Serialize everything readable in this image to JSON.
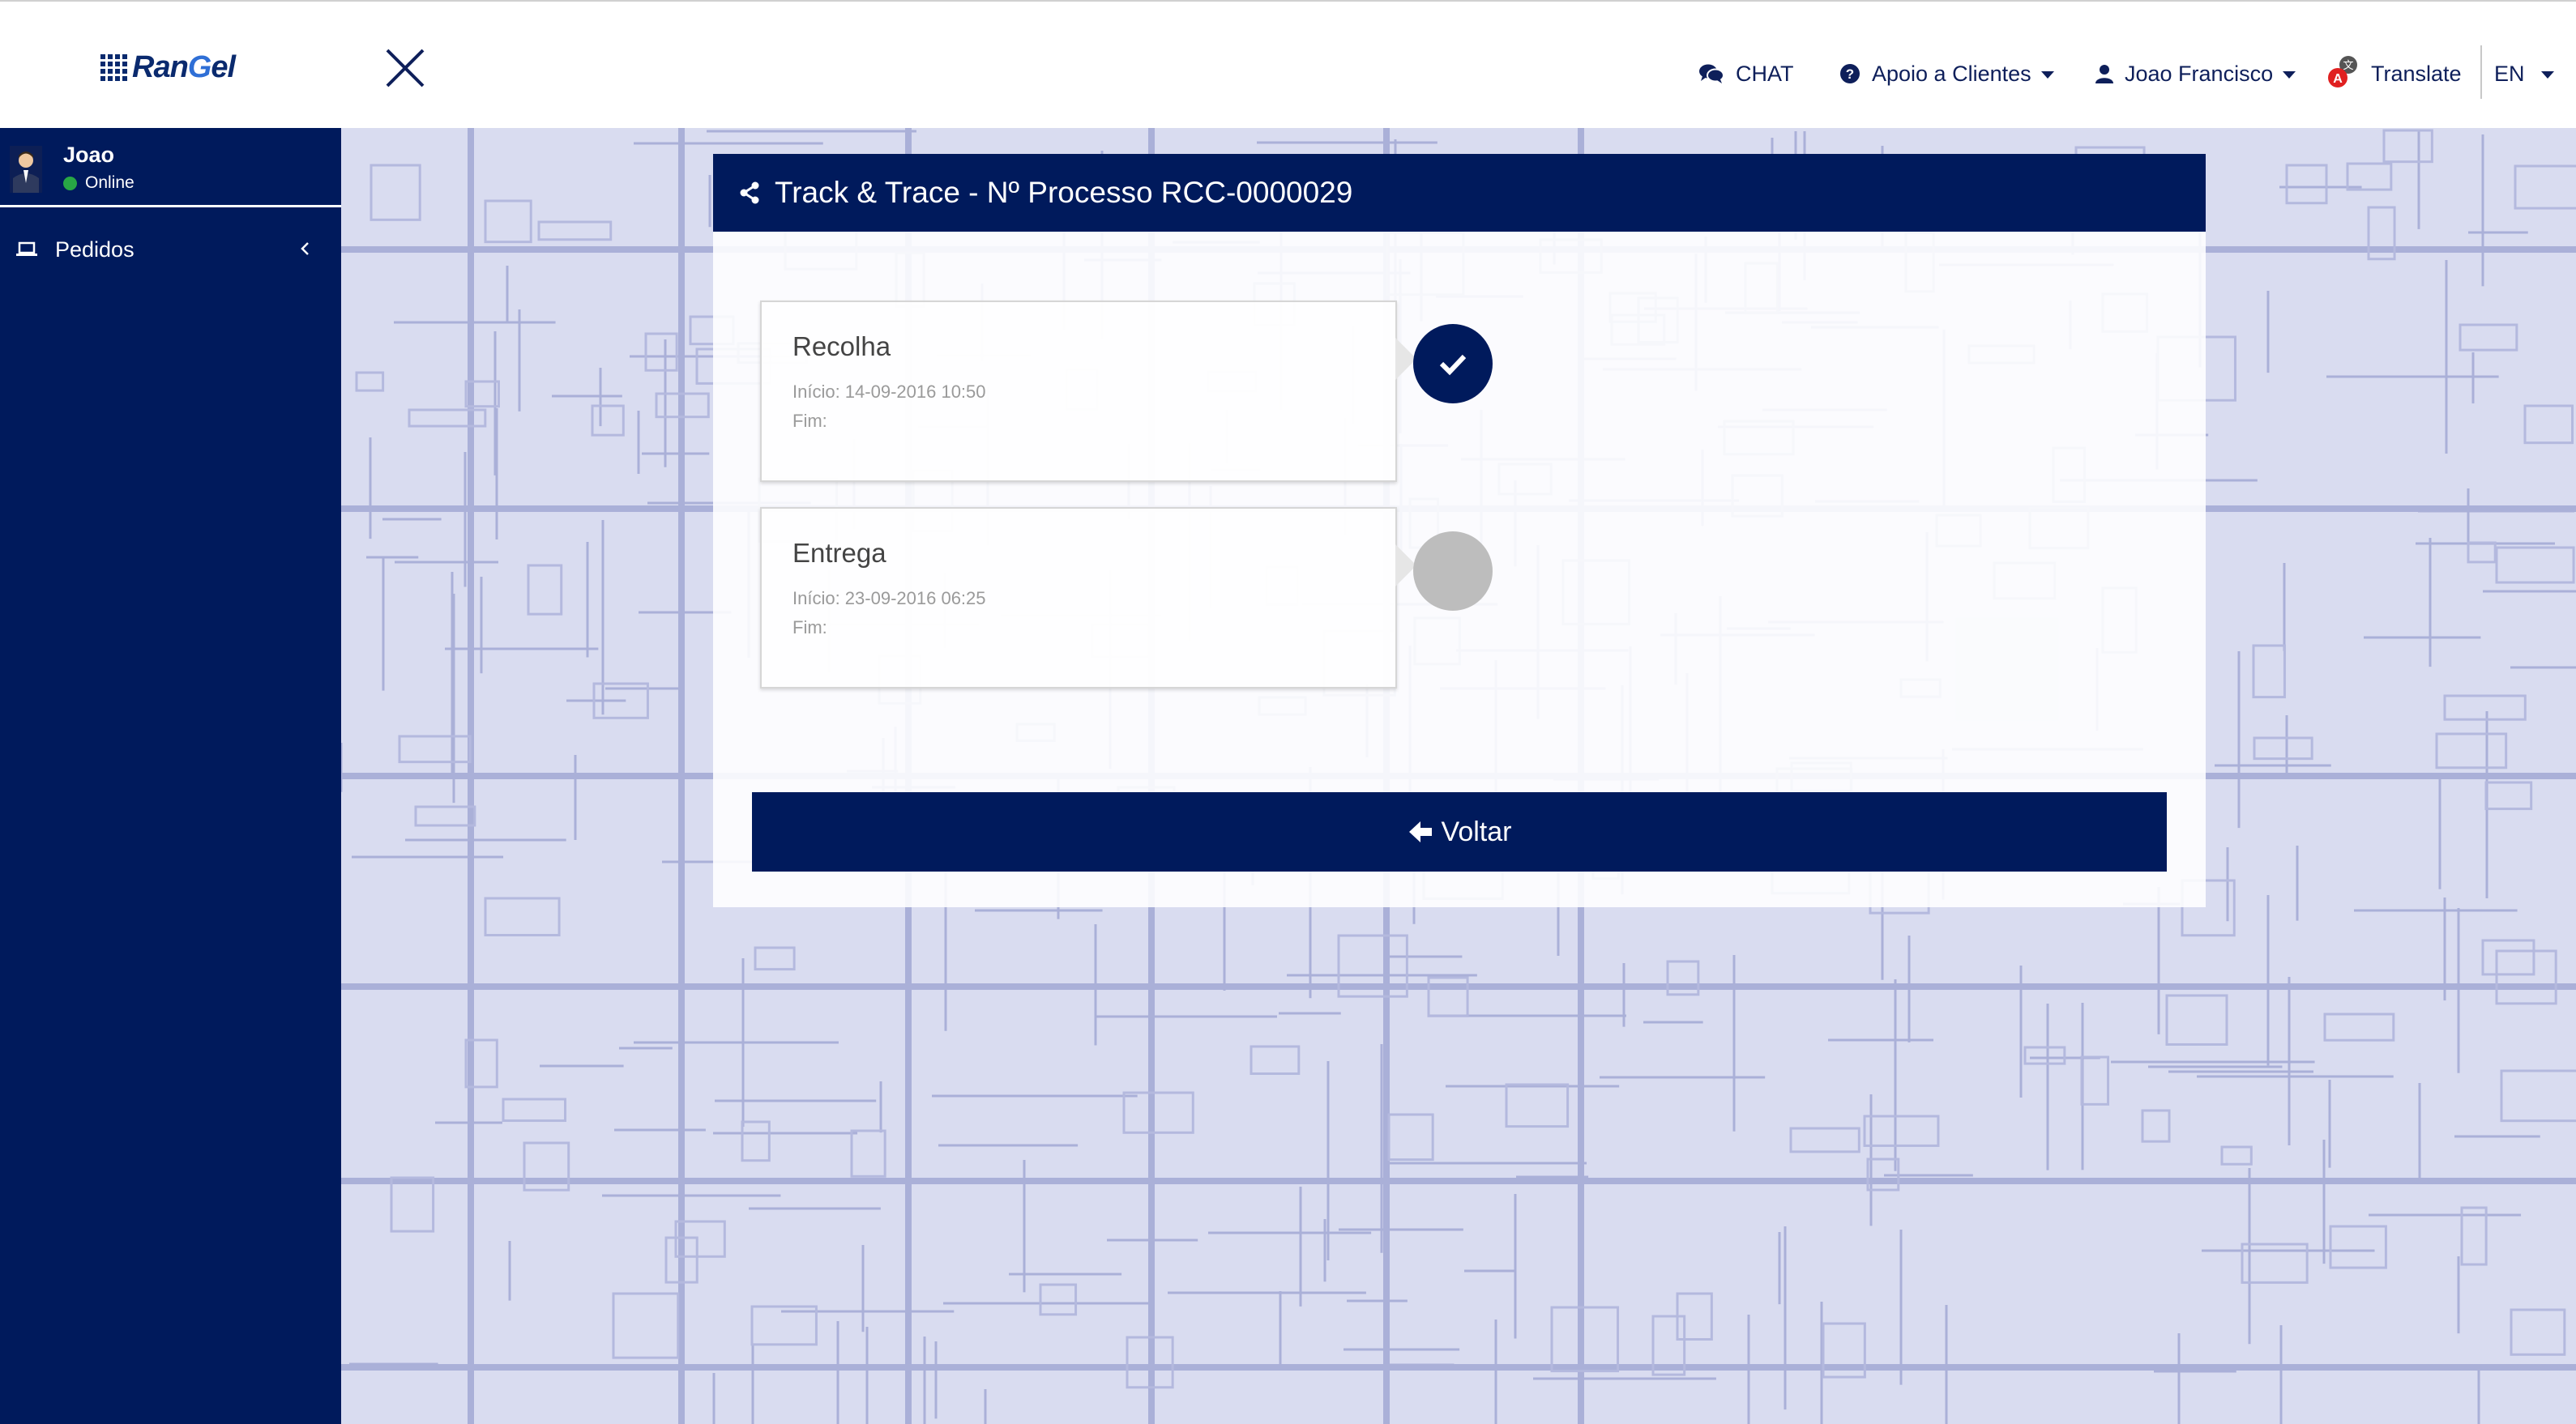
{
  "app": {
    "logo_text_prefix": "Ran",
    "logo_text_g": "G",
    "logo_text_suffix": "el"
  },
  "header": {
    "chat_label": "CHAT",
    "support_label": "Apoio a Clientes",
    "user_menu_label": "Joao Francisco",
    "translate_label": "Translate",
    "language_label": "EN",
    "translate_badge": "A"
  },
  "sidebar": {
    "user": {
      "name": "Joao",
      "status": "Online"
    },
    "items": [
      {
        "label": "Pedidos"
      }
    ]
  },
  "panel": {
    "title": "Track & Trace - Nº Processo RCC-0000029",
    "steps": [
      {
        "title": "Recolha",
        "start": "Início: 14-09-2016 10:50",
        "end": "Fim:",
        "completed": true
      },
      {
        "title": "Entrega",
        "start": "Início: 23-09-2016 06:25",
        "end": "Fim:",
        "completed": false
      }
    ],
    "back_label": "Voltar"
  },
  "colors": {
    "navy": "#001a5c",
    "map_bg": "#d9dcf0",
    "status_online": "#28a745",
    "pending_grey": "#bdbdbd"
  }
}
